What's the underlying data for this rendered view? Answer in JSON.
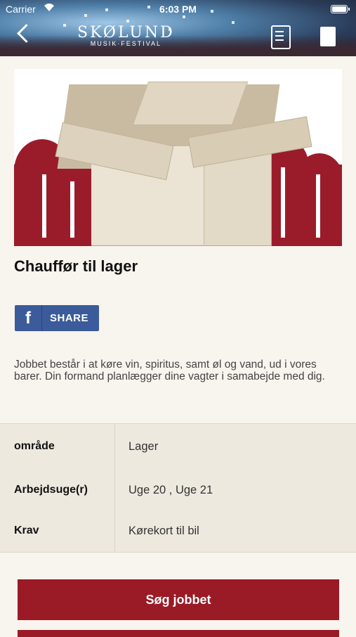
{
  "status_bar": {
    "carrier": "Carrier",
    "time": "6:03 PM"
  },
  "header": {
    "logo_line1": "SKØLUND",
    "logo_line2": "MUSIK·FESTIVAL",
    "back_icon": "chevron-left-icon",
    "edit_icon": "document-edit-icon",
    "doc_icon": "document-icon"
  },
  "job": {
    "title": "Chauffør til lager",
    "share_label": "SHARE",
    "description": "Jobbet består i at køre vin, spiritus, samt øl og vand, ud i vores barer. Din formand planlægger dine vagter i samabejde med dig."
  },
  "details": [
    {
      "label": "område",
      "value": "Lager"
    },
    {
      "label": "Arbejdsuge(r)",
      "value": "Uge 20 , Uge 21"
    },
    {
      "label": "Krav",
      "value": "Kørekort til bil"
    }
  ],
  "apply_label": "Søg jobbet",
  "colors": {
    "accent": "#9a1a26",
    "facebook": "#3b5b9a",
    "background": "#f8f4ee"
  }
}
